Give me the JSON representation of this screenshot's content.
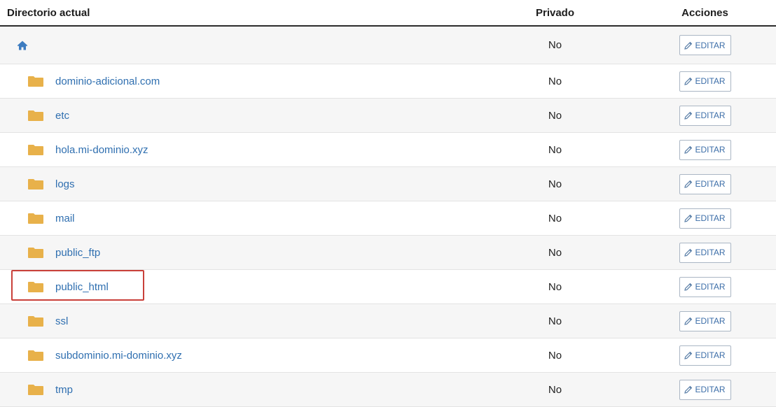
{
  "header": {
    "name_col": "Directorio actual",
    "private_col": "Privado",
    "actions_col": "Acciones"
  },
  "home_row": {
    "icon": "home-icon",
    "private": "No",
    "edit_label": "EDITAR"
  },
  "rows": [
    {
      "name": "dominio-adicional.com",
      "private": "No",
      "edit_label": "EDITAR"
    },
    {
      "name": "etc",
      "private": "No",
      "edit_label": "EDITAR"
    },
    {
      "name": "hola.mi-dominio.xyz",
      "private": "No",
      "edit_label": "EDITAR"
    },
    {
      "name": "logs",
      "private": "No",
      "edit_label": "EDITAR"
    },
    {
      "name": "mail",
      "private": "No",
      "edit_label": "EDITAR"
    },
    {
      "name": "public_ftp",
      "private": "No",
      "edit_label": "EDITAR"
    },
    {
      "name": "public_html",
      "private": "No",
      "edit_label": "EDITAR"
    },
    {
      "name": "ssl",
      "private": "No",
      "edit_label": "EDITAR"
    },
    {
      "name": "subdominio.mi-dominio.xyz",
      "private": "No",
      "edit_label": "EDITAR"
    },
    {
      "name": "tmp",
      "private": "No",
      "edit_label": "EDITAR"
    }
  ],
  "colors": {
    "link": "#2f6fb0",
    "folder": "#e8b14a",
    "highlight": "#c9403a"
  }
}
